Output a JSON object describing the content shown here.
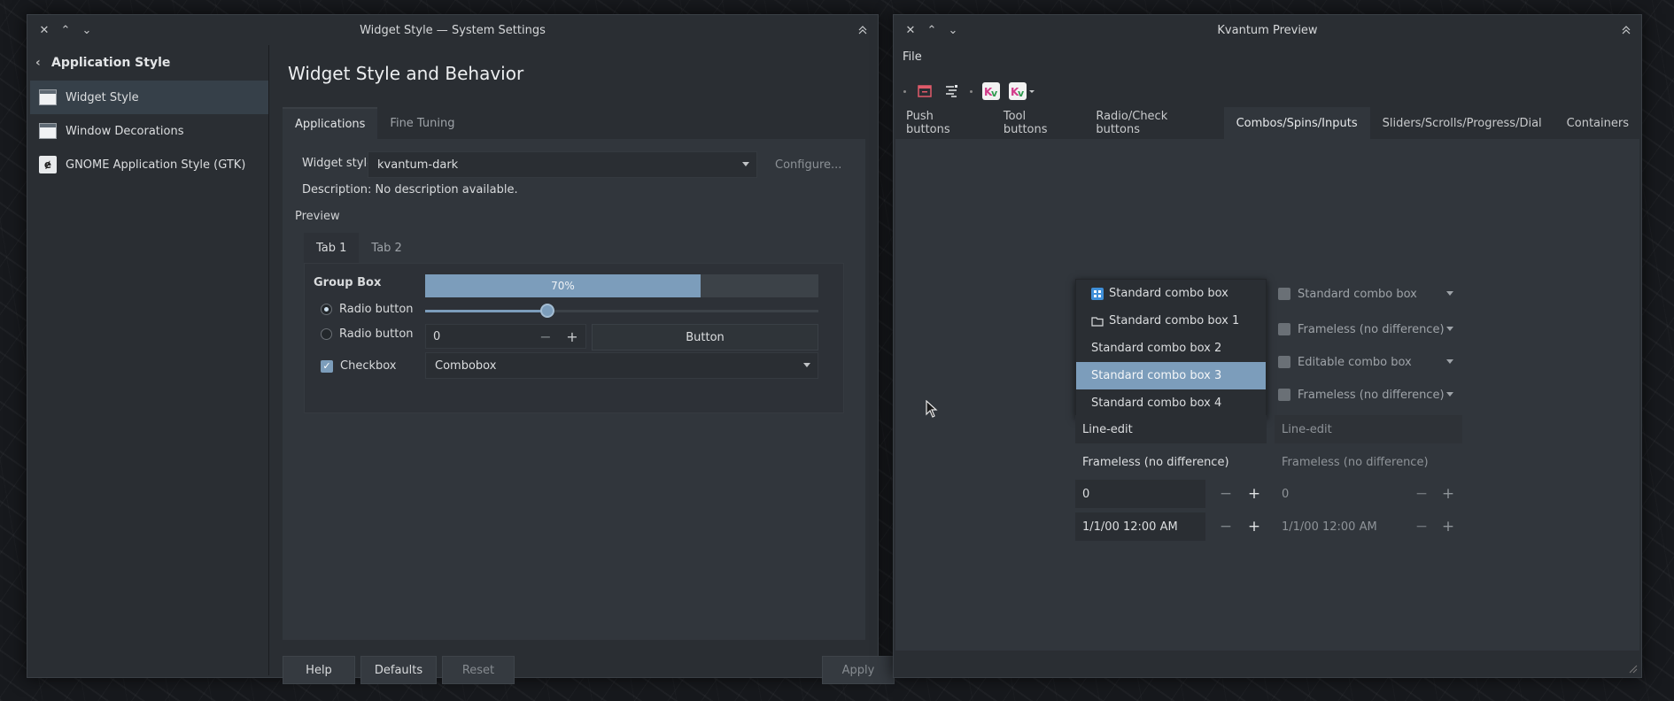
{
  "settings_window": {
    "title": "Widget Style — System Settings",
    "sidebar": {
      "back_label": "Application Style",
      "items": [
        {
          "label": "Widget Style",
          "active": true
        },
        {
          "label": "Window Decorations",
          "active": false
        },
        {
          "label": "GNOME Application Style (GTK)",
          "active": false
        }
      ]
    },
    "page_title": "Widget Style and Behavior",
    "tabs": [
      {
        "label": "Applications",
        "active": true
      },
      {
        "label": "Fine Tuning",
        "active": false
      }
    ],
    "widget_style_label": "Widget style:",
    "widget_style_value": "kvantum-dark",
    "configure_label": "Configure...",
    "description": "Description: No description available.",
    "preview_label": "Preview",
    "preview_tabs": [
      {
        "label": "Tab 1",
        "active": true
      },
      {
        "label": "Tab 2",
        "active": false
      }
    ],
    "group_box_label": "Group Box",
    "progress_text": "70%",
    "progress_value": 0.7,
    "slider_value": 0.31,
    "radio1_label": "Radio button",
    "radio2_label": "Radio button",
    "checkbox_label": "Checkbox",
    "spin_value": "0",
    "button_label": "Button",
    "combobox_value": "Combobox",
    "footer": {
      "help": "Help",
      "defaults": "Defaults",
      "reset": "Reset",
      "apply": "Apply"
    }
  },
  "kvantum_window": {
    "title": "Kvantum Preview",
    "menu_file": "File",
    "tabs": [
      {
        "label": "Push buttons",
        "active": false
      },
      {
        "label": "Tool buttons",
        "active": false
      },
      {
        "label": "Radio/Check buttons",
        "active": false
      },
      {
        "label": "Combos/Spins/Inputs",
        "active": true
      },
      {
        "label": "Sliders/Scrolls/Progress/Dial",
        "active": false
      },
      {
        "label": "Containers",
        "active": false
      }
    ],
    "dropdown_items": [
      {
        "label": "Standard combo box",
        "icon": "blue-app-icon",
        "highlighted": false
      },
      {
        "label": "Standard combo box 1",
        "icon": "folder-icon",
        "highlighted": false
      },
      {
        "label": "Standard combo box 2",
        "icon": "",
        "highlighted": false
      },
      {
        "label": "Standard combo box 3",
        "icon": "",
        "highlighted": true
      },
      {
        "label": "Standard combo box 4",
        "icon": "",
        "highlighted": false
      }
    ],
    "right_combos": [
      "Standard combo box",
      "Frameless (no difference)",
      "Editable combo box",
      "Frameless (no difference)"
    ],
    "line_edit_left": "Line-edit",
    "line_edit_right": "Line-edit",
    "frameless_left": "Frameless (no difference)",
    "frameless_right": "Frameless (no difference)",
    "spin_left": "0",
    "spin_right": "0",
    "date_left": "1/1/00 12:00 AM",
    "date_right": "1/1/00 12:00 AM"
  },
  "colors": {
    "accent": "#7c9dbb",
    "window_bg": "#2a2e33",
    "panel_bg": "#31363c"
  }
}
